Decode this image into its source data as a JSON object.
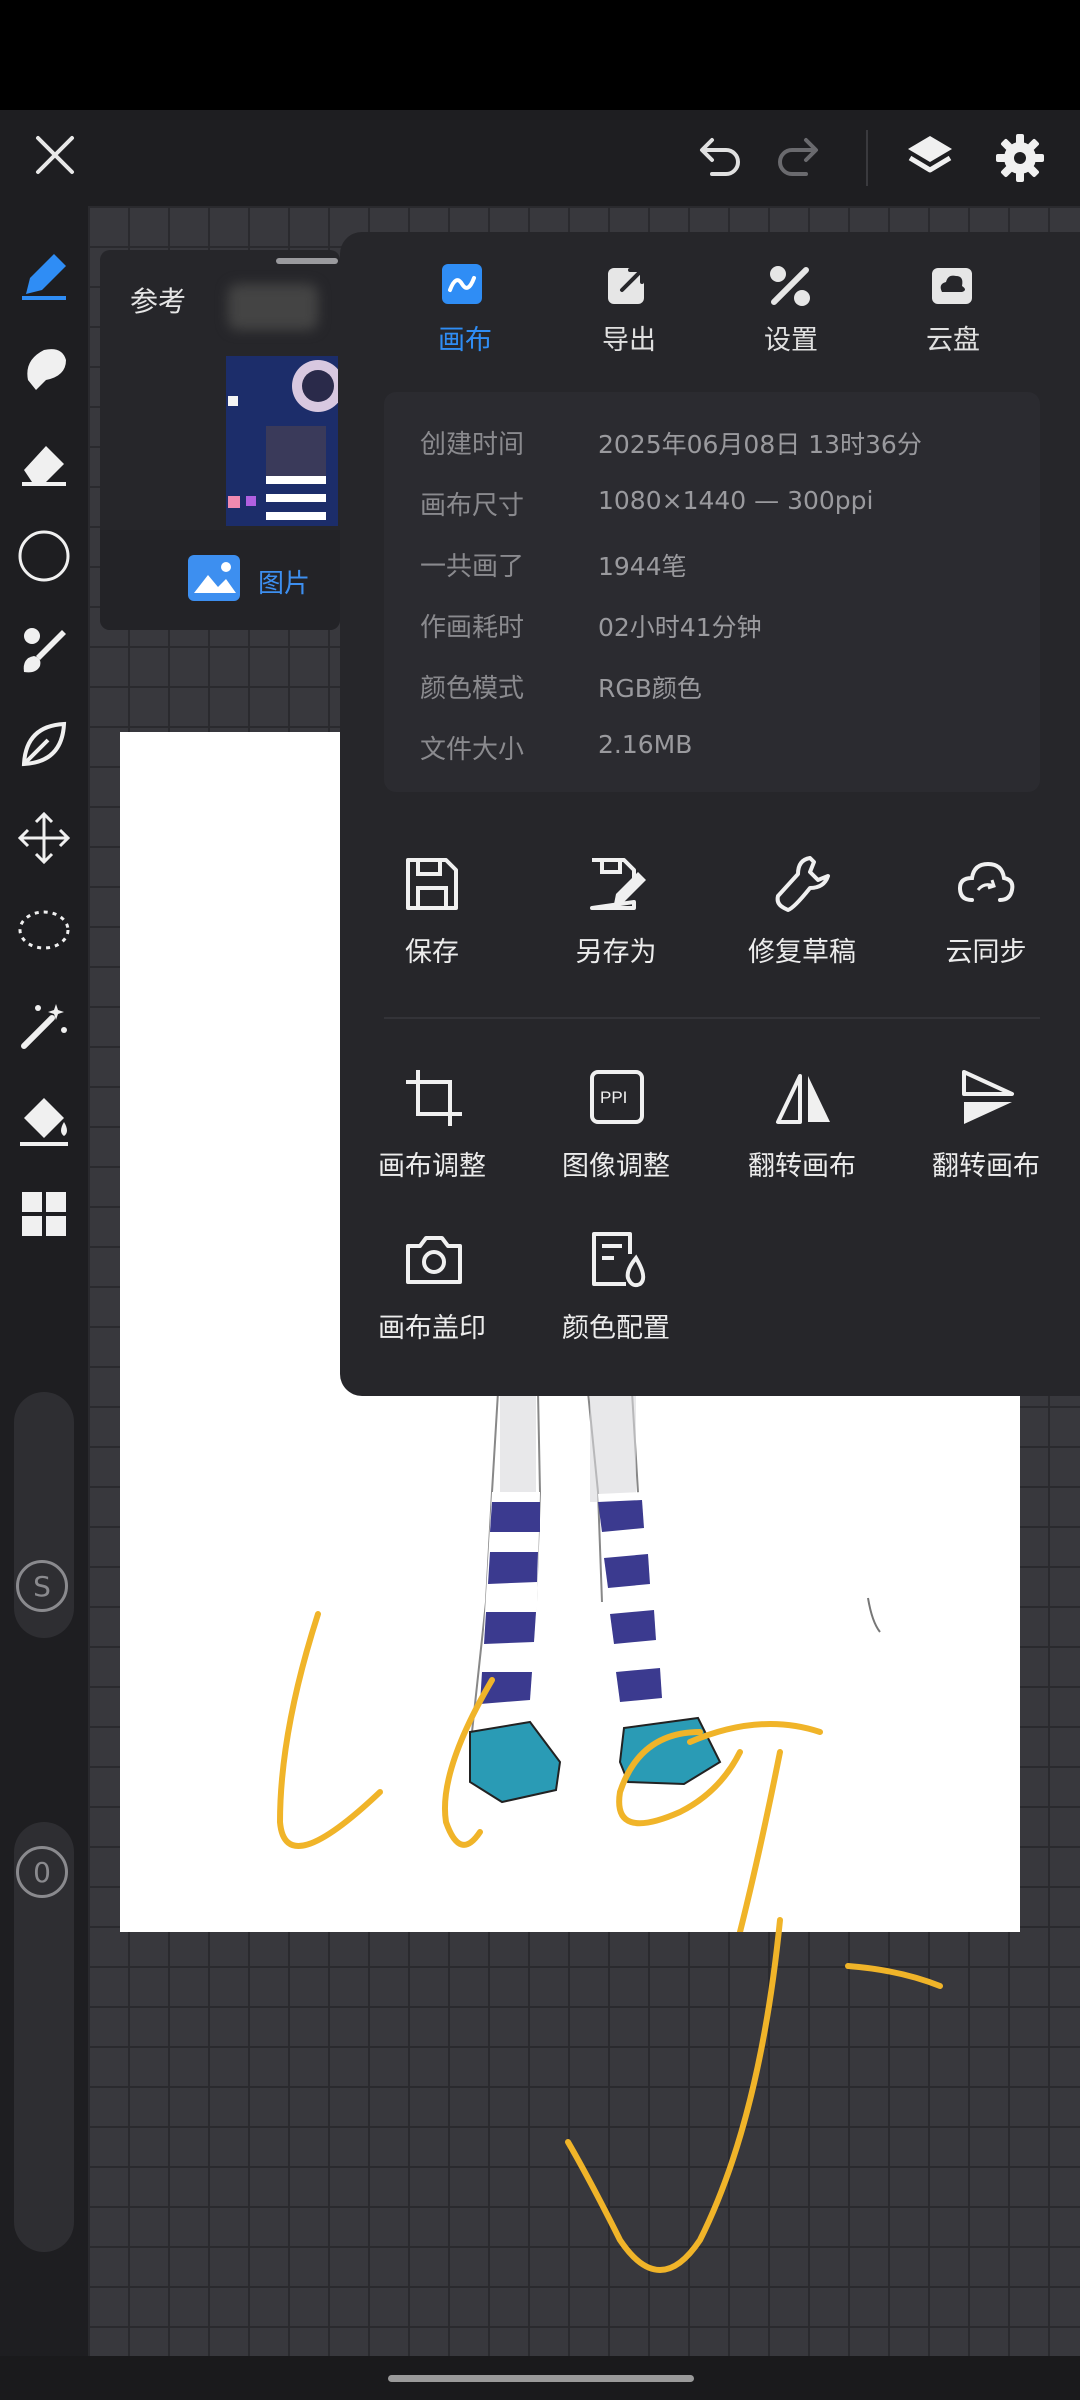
{
  "header": {
    "icons": [
      "close-icon",
      "undo-icon",
      "redo-icon",
      "layers-icon",
      "gear-icon"
    ]
  },
  "toolbar": {
    "tools": [
      "pen-tool-icon",
      "smudge-icon",
      "eraser-icon",
      "circle-icon",
      "paint-brush-icon",
      "leaf-icon",
      "move-icon",
      "lasso-icon",
      "magic-wand-icon",
      "bucket-icon",
      "grid-icon"
    ],
    "active_color": "#2f8df5",
    "size_slider_label": "S",
    "opacity_slider_label": "0"
  },
  "reference_panel": {
    "title": "参考",
    "image_button": "图片"
  },
  "menu": {
    "tabs": [
      {
        "label": "画布",
        "icon": "canvas-icon",
        "active": true
      },
      {
        "label": "导出",
        "icon": "export-icon",
        "active": false
      },
      {
        "label": "设置",
        "icon": "tools-icon",
        "active": false
      },
      {
        "label": "云盘",
        "icon": "cloud-disk-icon",
        "active": false
      }
    ],
    "info": [
      {
        "label": "创建时间",
        "value": "2025年06月08日 13时36分"
      },
      {
        "label": "画布尺寸",
        "value": "1080×1440 — 300ppi"
      },
      {
        "label": "一共画了",
        "value": "1944笔"
      },
      {
        "label": "作画耗时",
        "value": "02小时41分钟"
      },
      {
        "label": "颜色模式",
        "value": "RGB颜色"
      },
      {
        "label": "文件大小",
        "value": "2.16MB"
      }
    ],
    "actions_row1": [
      {
        "label": "保存",
        "icon": "save-icon"
      },
      {
        "label": "另存为",
        "icon": "save-as-icon"
      },
      {
        "label": "修复草稿",
        "icon": "wrench-icon"
      },
      {
        "label": "云同步",
        "icon": "cloud-sync-icon"
      }
    ],
    "actions_row2": [
      {
        "label": "画布调整",
        "icon": "crop-icon"
      },
      {
        "label": "图像调整",
        "icon": "ppi-icon",
        "icon_text": "PPI"
      },
      {
        "label": "翻转画布",
        "icon": "flip-horizontal-icon"
      },
      {
        "label": "翻转画布",
        "icon": "flip-vertical-icon"
      }
    ],
    "actions_row3": [
      {
        "label": "画布盖印",
        "icon": "camera-icon"
      },
      {
        "label": "颜色配置",
        "icon": "color-profile-icon"
      }
    ]
  },
  "colors": {
    "accent": "#2f8df5",
    "menu_bg": "#26262a",
    "stroke_yellow": "#f0b429",
    "sock_blue": "#3b3a8f",
    "shoe_teal": "#2a9bb5"
  }
}
